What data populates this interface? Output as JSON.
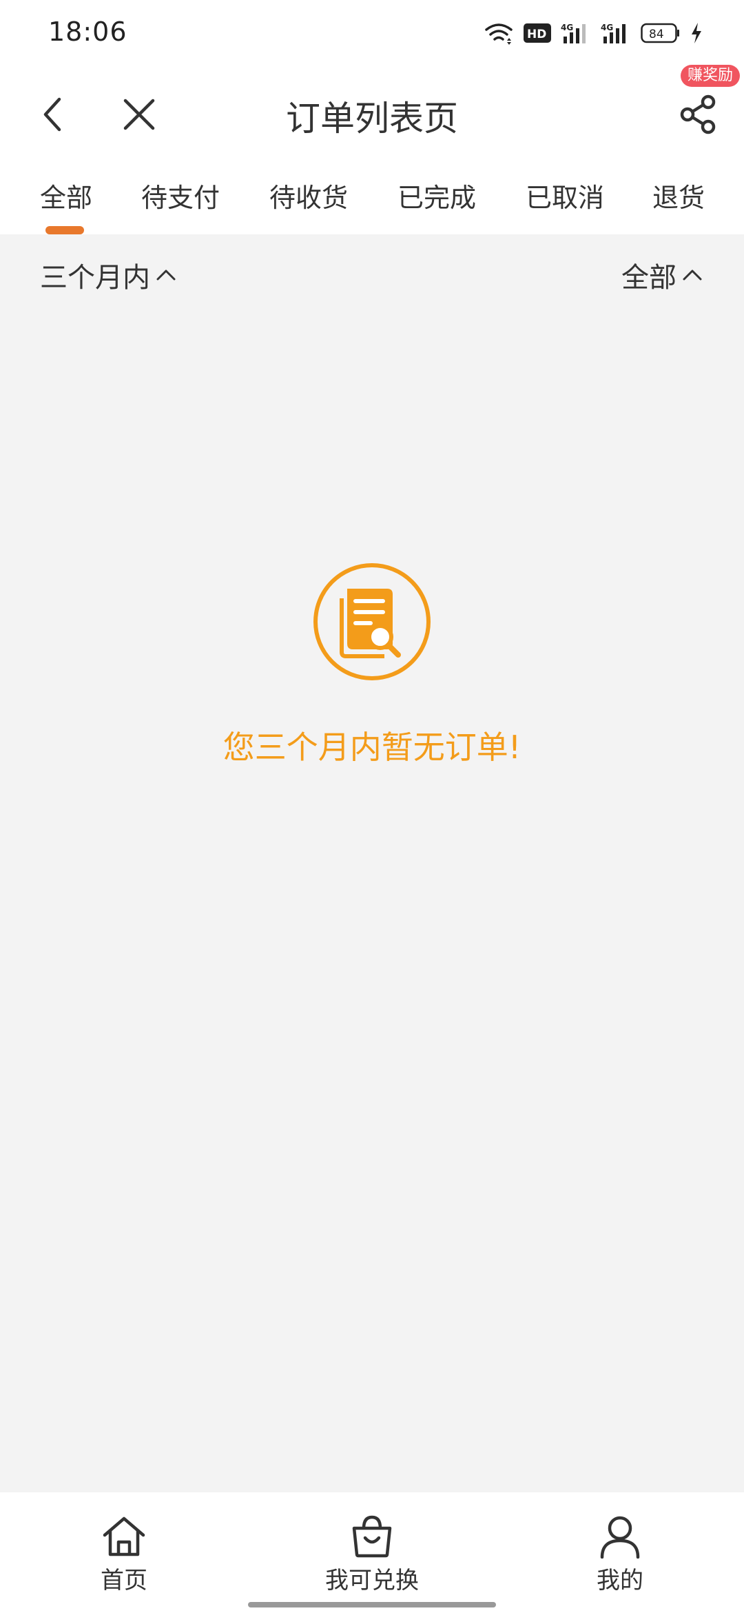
{
  "status_bar": {
    "time": "18:06",
    "battery": "84",
    "network_labels": [
      "HD",
      "4G",
      "4G"
    ]
  },
  "navbar": {
    "title": "订单列表页",
    "reward_badge": "赚奖励"
  },
  "tabs": [
    {
      "label": "全部",
      "active": true
    },
    {
      "label": "待支付",
      "active": false
    },
    {
      "label": "待收货",
      "active": false
    },
    {
      "label": "已完成",
      "active": false
    },
    {
      "label": "已取消",
      "active": false
    },
    {
      "label": "退货",
      "active": false
    }
  ],
  "filters": {
    "time_range": "三个月内",
    "status": "全部"
  },
  "empty_state": {
    "message": "您三个月内暂无订单!",
    "icon": "order-search-icon"
  },
  "bottom_nav": [
    {
      "label": "首页",
      "icon": "home-icon"
    },
    {
      "label": "我可兑换",
      "icon": "shopping-bag-icon"
    },
    {
      "label": "我的",
      "icon": "user-icon"
    }
  ],
  "colors": {
    "accent": "#e8782c",
    "empty_text": "#f39c1a",
    "badge": "#f0555f",
    "background": "#f3f3f3"
  }
}
